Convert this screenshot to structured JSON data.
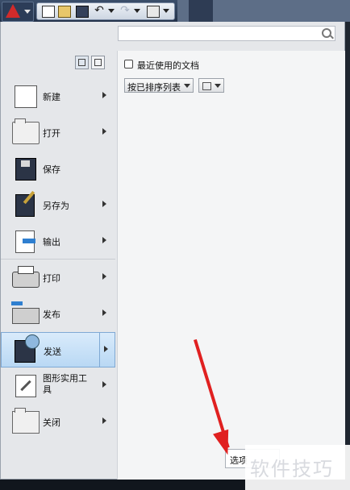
{
  "toolbar": {
    "app_menu_icon": "autocad-logo-icon",
    "buttons": [
      "new-icon",
      "open-icon",
      "save-icon",
      "undo-icon",
      "redo-icon",
      "print-icon",
      "more-icon"
    ]
  },
  "search": {
    "placeholder": ""
  },
  "commands": [
    {
      "label": "新建",
      "icon": "new-document-icon",
      "has_submenu": true
    },
    {
      "label": "打开",
      "icon": "open-folder-icon",
      "has_submenu": true
    },
    {
      "label": "保存",
      "icon": "save-icon",
      "has_submenu": false
    },
    {
      "label": "另存为",
      "icon": "save-as-icon",
      "has_submenu": true
    },
    {
      "label": "输出",
      "icon": "export-icon",
      "has_submenu": true
    },
    {
      "label": "打印",
      "icon": "print-icon",
      "has_submenu": true
    },
    {
      "label": "发布",
      "icon": "publish-icon",
      "has_submenu": true
    },
    {
      "label": "发送",
      "icon": "send-icon",
      "has_submenu": true,
      "active": true
    },
    {
      "label": "图形实用工具",
      "icon": "drawing-utilities-icon",
      "has_submenu": true
    },
    {
      "label": "关闭",
      "icon": "close-folder-icon",
      "has_submenu": true
    }
  ],
  "recent": {
    "title": "最近使用的文档",
    "sort_label": "按已排序列表"
  },
  "options_button": "选项",
  "watermark": "软件技巧",
  "colors": {
    "active_bg": "#b9d8f4",
    "annotation_arrow": "#e02020"
  }
}
